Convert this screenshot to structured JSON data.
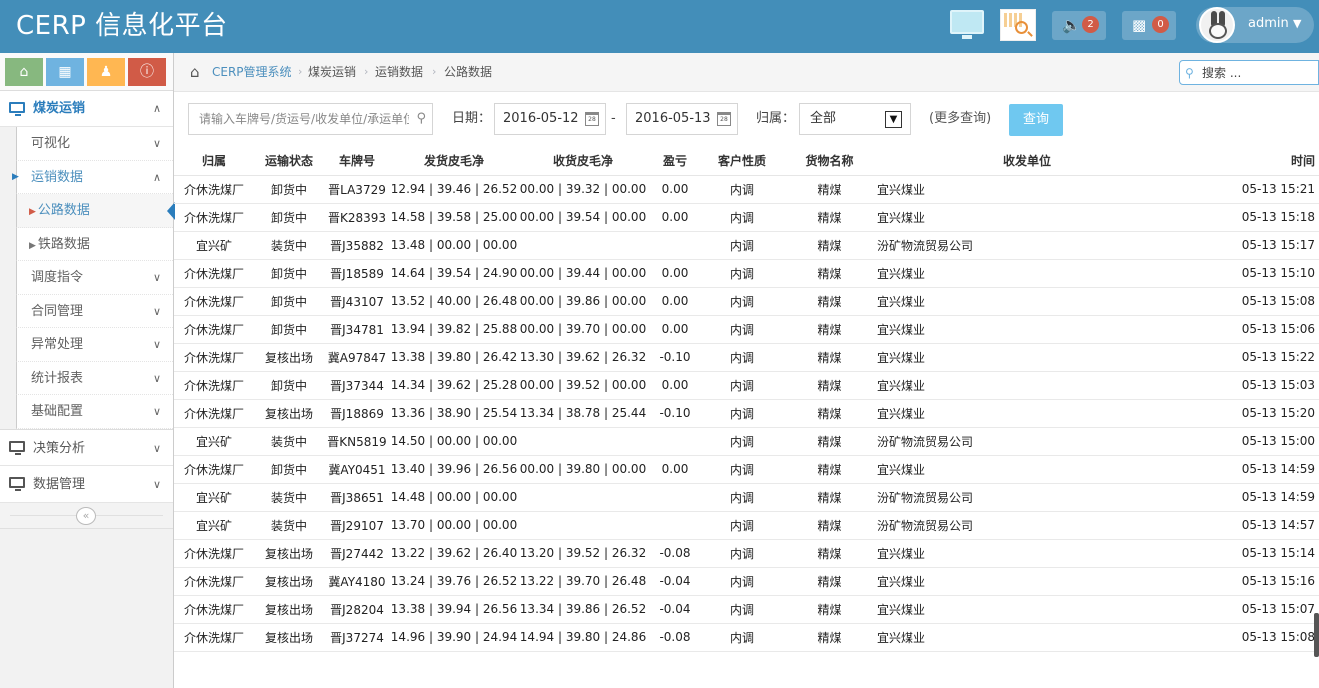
{
  "header": {
    "brand": "CERP 信息化平台",
    "notifications_count": "2",
    "messages_count": "0",
    "user_name": "admin"
  },
  "sidebar": {
    "shortcut_icons": [
      "home-icon",
      "calendar-icon",
      "user-icon",
      "info-icon"
    ],
    "sections": [
      {
        "label": "煤炭运销",
        "icon": "monitor-icon"
      },
      {
        "label": "决策分析",
        "icon": "monitor-icon"
      },
      {
        "label": "数据管理",
        "icon": "monitor-icon"
      }
    ],
    "sub_items": [
      "可视化",
      "运销数据",
      "调度指令",
      "合同管理",
      "异常处理",
      "统计报表",
      "基础配置"
    ],
    "sub_sub_items": [
      "公路数据",
      "铁路数据"
    ]
  },
  "breadcrumb": {
    "items": [
      "CERP管理系统",
      "煤炭运销",
      "运销数据",
      "公路数据"
    ],
    "search_placeholder": "搜索 ..."
  },
  "filters": {
    "search_placeholder": "请输入车牌号/货运号/收发单位/承运单位...",
    "date_label": "日期：",
    "date_from": "2016-05-12",
    "date_sep": "-",
    "date_to": "2016-05-13",
    "owner_label": "归属：",
    "owner_value": "全部",
    "more_query": "(更多查询)",
    "query_button": "查询"
  },
  "table": {
    "headers": [
      "归属",
      "运输状态",
      "车牌号",
      "发货皮毛净",
      "收货皮毛净",
      "盈亏",
      "客户性质",
      "货物名称",
      "收发单位",
      "时间"
    ],
    "rows": [
      [
        "介休洗煤厂",
        "卸货中",
        "晋LA3729",
        "12.94 | 39.46 | 26.52",
        "00.00 | 39.32 | 00.00",
        "0.00",
        "内调",
        "精煤",
        "宜兴煤业",
        "05-13 15:21"
      ],
      [
        "介休洗煤厂",
        "卸货中",
        "晋K28393",
        "14.58 | 39.58 | 25.00",
        "00.00 | 39.54 | 00.00",
        "0.00",
        "内调",
        "精煤",
        "宜兴煤业",
        "05-13 15:18"
      ],
      [
        "宜兴矿",
        "装货中",
        "晋J35882",
        "13.48 | 00.00 | 00.00",
        "",
        "",
        "内调",
        "精煤",
        "汾矿物流贸易公司",
        "05-13 15:17"
      ],
      [
        "介休洗煤厂",
        "卸货中",
        "晋J18589",
        "14.64 | 39.54 | 24.90",
        "00.00 | 39.44 | 00.00",
        "0.00",
        "内调",
        "精煤",
        "宜兴煤业",
        "05-13 15:10"
      ],
      [
        "介休洗煤厂",
        "卸货中",
        "晋J43107",
        "13.52 | 40.00 | 26.48",
        "00.00 | 39.86 | 00.00",
        "0.00",
        "内调",
        "精煤",
        "宜兴煤业",
        "05-13 15:08"
      ],
      [
        "介休洗煤厂",
        "卸货中",
        "晋J34781",
        "13.94 | 39.82 | 25.88",
        "00.00 | 39.70 | 00.00",
        "0.00",
        "内调",
        "精煤",
        "宜兴煤业",
        "05-13 15:06"
      ],
      [
        "介休洗煤厂",
        "复核出场",
        "冀A97847",
        "13.38 | 39.80 | 26.42",
        "13.30 | 39.62 | 26.32",
        "-0.10",
        "内调",
        "精煤",
        "宜兴煤业",
        "05-13 15:22"
      ],
      [
        "介休洗煤厂",
        "卸货中",
        "晋J37344",
        "14.34 | 39.62 | 25.28",
        "00.00 | 39.52 | 00.00",
        "0.00",
        "内调",
        "精煤",
        "宜兴煤业",
        "05-13 15:03"
      ],
      [
        "介休洗煤厂",
        "复核出场",
        "晋J18869",
        "13.36 | 38.90 | 25.54",
        "13.34 | 38.78 | 25.44",
        "-0.10",
        "内调",
        "精煤",
        "宜兴煤业",
        "05-13 15:20"
      ],
      [
        "宜兴矿",
        "装货中",
        "晋KN5819",
        "14.50 | 00.00 | 00.00",
        "",
        "",
        "内调",
        "精煤",
        "汾矿物流贸易公司",
        "05-13 15:00"
      ],
      [
        "介休洗煤厂",
        "卸货中",
        "冀AY0451",
        "13.40 | 39.96 | 26.56",
        "00.00 | 39.80 | 00.00",
        "0.00",
        "内调",
        "精煤",
        "宜兴煤业",
        "05-13 14:59"
      ],
      [
        "宜兴矿",
        "装货中",
        "晋J38651",
        "14.48 | 00.00 | 00.00",
        "",
        "",
        "内调",
        "精煤",
        "汾矿物流贸易公司",
        "05-13 14:59"
      ],
      [
        "宜兴矿",
        "装货中",
        "晋J29107",
        "13.70 | 00.00 | 00.00",
        "",
        "",
        "内调",
        "精煤",
        "汾矿物流贸易公司",
        "05-13 14:57"
      ],
      [
        "介休洗煤厂",
        "复核出场",
        "晋J27442",
        "13.22 | 39.62 | 26.40",
        "13.20 | 39.52 | 26.32",
        "-0.08",
        "内调",
        "精煤",
        "宜兴煤业",
        "05-13 15:14"
      ],
      [
        "介休洗煤厂",
        "复核出场",
        "冀AY4180",
        "13.24 | 39.76 | 26.52",
        "13.22 | 39.70 | 26.48",
        "-0.04",
        "内调",
        "精煤",
        "宜兴煤业",
        "05-13 15:16"
      ],
      [
        "介休洗煤厂",
        "复核出场",
        "晋J28204",
        "13.38 | 39.94 | 26.56",
        "13.34 | 39.86 | 26.52",
        "-0.04",
        "内调",
        "精煤",
        "宜兴煤业",
        "05-13 15:07"
      ],
      [
        "介休洗煤厂",
        "复核出场",
        "晋J37274",
        "14.96 | 39.90 | 24.94",
        "14.94 | 39.80 | 24.86",
        "-0.08",
        "内调",
        "精煤",
        "宜兴煤业",
        "05-13 15:08"
      ]
    ]
  }
}
